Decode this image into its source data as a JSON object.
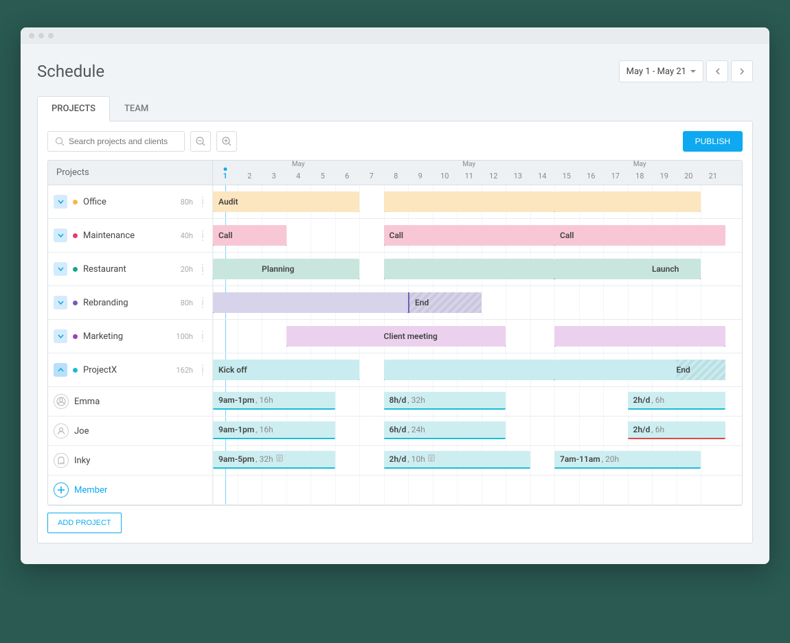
{
  "title": "Schedule",
  "dateRange": "May 1 - May 21",
  "tabs": {
    "projects": "PROJECTS",
    "team": "TEAM"
  },
  "search": {
    "placeholder": "Search projects and clients"
  },
  "publish": "PUBLISH",
  "projectsHeader": "Projects",
  "monthLabel": "May",
  "days": [
    1,
    2,
    3,
    4,
    5,
    6,
    7,
    8,
    9,
    10,
    11,
    12,
    13,
    14,
    15,
    16,
    17,
    18,
    19,
    20,
    21
  ],
  "weekendDays": [
    6,
    7,
    13,
    14,
    20,
    21
  ],
  "today": 1,
  "projects": [
    {
      "name": "Office",
      "hours": "80h",
      "color": "#f5b942",
      "barBg": "#fbe6c0",
      "bars": [
        {
          "start": 1,
          "end": 6,
          "label": "Audit"
        },
        {
          "start": 8,
          "end": 14
        },
        {
          "start": 15,
          "end": 20
        }
      ]
    },
    {
      "name": "Maintenance",
      "hours": "40h",
      "color": "#e63976",
      "barBg": "#f8c7d5",
      "bars": [
        {
          "start": 1,
          "end": 3,
          "label": "Call"
        },
        {
          "start": 8,
          "end": 10,
          "label": "Call",
          "trail": 21
        },
        {
          "start": 15,
          "end": 17,
          "label": "Call",
          "trail": 21
        }
      ]
    },
    {
      "name": "Restaurant",
      "hours": "20h",
      "color": "#17a589",
      "barBg": "#c8e6dd",
      "bars": [
        {
          "start": 1,
          "end": 6,
          "label": "Planning",
          "labelOffset": 2
        },
        {
          "start": 8,
          "end": 14
        },
        {
          "start": 15,
          "end": 20,
          "label": "Launch",
          "labelOffset": 4
        }
      ]
    },
    {
      "name": "Rebranding",
      "hours": "80h",
      "color": "#6e5eb8",
      "barBg": "#d6d3ea",
      "bars": [
        {
          "start": 1,
          "end": 8
        }
      ],
      "milestone": {
        "start": 9,
        "end": 11,
        "label": "End"
      }
    },
    {
      "name": "Marketing",
      "hours": "100h",
      "color": "#a13fb8",
      "barBg": "#ecd1ee",
      "bars": [
        {
          "start": 4,
          "end": 12,
          "label": "Client meeting",
          "labelOffset": 4
        },
        {
          "start": 15,
          "end": 21
        }
      ]
    },
    {
      "name": "ProjectX",
      "hours": "162h",
      "color": "#1abcd4",
      "barBg": "#c8ecef",
      "expanded": true,
      "bars": [
        {
          "start": 1,
          "end": 6,
          "label": "Kick off"
        },
        {
          "start": 8,
          "end": 14
        },
        {
          "start": 15,
          "end": 21,
          "label": "End",
          "labelOffset": 5,
          "hatchFrom": 20
        }
      ]
    }
  ],
  "members": [
    {
      "name": "Emma",
      "icon": "user-hat",
      "bars": [
        {
          "start": 1,
          "end": 5,
          "t": "9am-1pm",
          "h": "16h"
        },
        {
          "start": 8,
          "end": 12,
          "t": "8h/d",
          "h": "32h"
        },
        {
          "start": 18,
          "end": 21,
          "t": "2h/d",
          "h": "6h"
        }
      ]
    },
    {
      "name": "Joe",
      "icon": "user",
      "bars": [
        {
          "start": 1,
          "end": 5,
          "t": "9am-1pm",
          "h": "16h"
        },
        {
          "start": 8,
          "end": 12,
          "t": "6h/d",
          "h": "24h"
        },
        {
          "start": 18,
          "end": 21,
          "t": "2h/d",
          "h": "6h",
          "over": true
        }
      ]
    },
    {
      "name": "Inky",
      "icon": "ghost",
      "bars": [
        {
          "start": 1,
          "end": 5,
          "t": "9am-5pm",
          "h": "32h",
          "note": true
        },
        {
          "start": 8,
          "end": 13,
          "t": "2h/d",
          "h": "10h",
          "note": true
        },
        {
          "start": 15,
          "end": 20,
          "t": "7am-11am",
          "h": "20h"
        }
      ]
    }
  ],
  "addMember": "Member",
  "addProject": "ADD PROJECT"
}
